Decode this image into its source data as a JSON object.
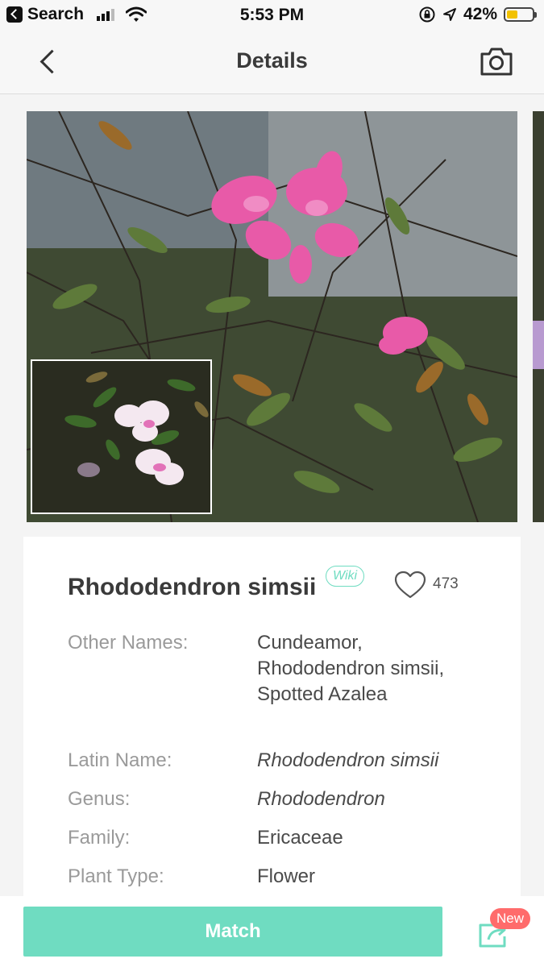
{
  "status_bar": {
    "back_app_label": "Search",
    "time": "5:53 PM",
    "battery": "42%",
    "battery_level": 0.42,
    "icons": [
      "signal-icon",
      "wifi-icon",
      "orientation-lock-icon",
      "location-icon",
      "battery-icon"
    ]
  },
  "nav": {
    "title": "Details",
    "back_icon": "chevron-left-icon",
    "camera_icon": "camera-icon"
  },
  "plant": {
    "name": "Rhododendron simsii",
    "wiki_label": "Wiki",
    "likes": "473",
    "details": [
      {
        "label": "Other Names:",
        "value": "Cundeamor, Rhododendron simsii, Spotted Azalea",
        "italic": false
      },
      {
        "label": "Latin Name:",
        "value": "Rhododendron simsii",
        "italic": true
      },
      {
        "label": "Genus:",
        "value": "Rhododendron",
        "italic": true
      },
      {
        "label": "Family:",
        "value": "Ericaceae",
        "italic": false
      },
      {
        "label": "Plant Type:",
        "value": "Flower",
        "italic": false
      }
    ]
  },
  "bottom": {
    "match_label": "Match",
    "new_badge": "New",
    "share_icon": "share-icon"
  },
  "colors": {
    "accent": "#6fdcc1",
    "badge": "#ff6b6b"
  }
}
